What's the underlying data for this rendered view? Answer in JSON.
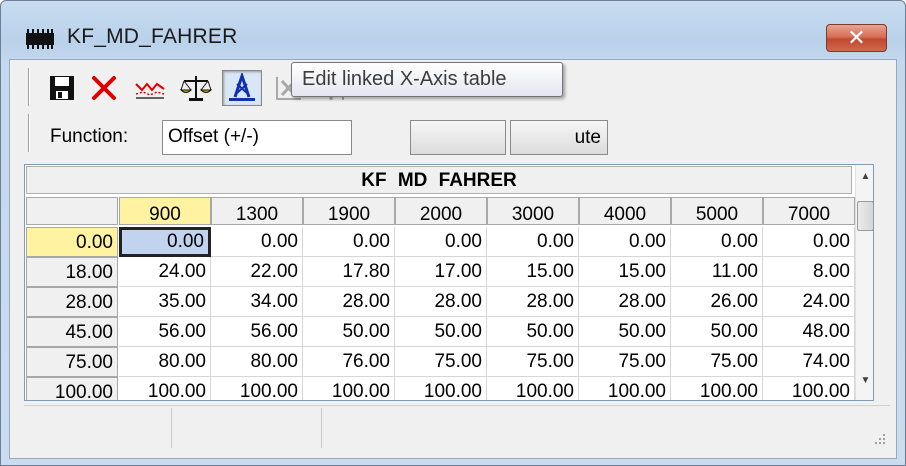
{
  "window": {
    "title": "KF_MD_FAHRER",
    "close_label": "✕"
  },
  "toolbar": {
    "buttons": [
      {
        "icon": "save-icon"
      },
      {
        "icon": "delete-icon"
      },
      {
        "icon": "line-chart-icon"
      },
      {
        "icon": "balance-scale-icon"
      },
      {
        "icon": "x-axis-table-icon",
        "active": true
      },
      {
        "icon": "x-axis-disabled-icon"
      },
      {
        "icon": "y-axis-disabled-icon"
      }
    ]
  },
  "function_bar": {
    "label": "Function:",
    "selected": "Offset (+/-)",
    "compute_label_visible": "ute"
  },
  "tooltip": {
    "text": "Edit linked X-Axis table"
  },
  "table": {
    "title": "KF  MD  FAHRER",
    "column_headers": [
      "900",
      "1300",
      "1900",
      "2000",
      "3000",
      "4000",
      "5000",
      "7000"
    ],
    "rows": [
      {
        "header": "0.00",
        "values": [
          "0.00",
          "0.00",
          "0.00",
          "0.00",
          "0.00",
          "0.00",
          "0.00",
          "0.00"
        ]
      },
      {
        "header": "18.00",
        "values": [
          "24.00",
          "22.00",
          "17.80",
          "17.00",
          "15.00",
          "15.00",
          "11.00",
          "8.00"
        ]
      },
      {
        "header": "28.00",
        "values": [
          "35.00",
          "34.00",
          "28.00",
          "28.00",
          "28.00",
          "28.00",
          "26.00",
          "24.00"
        ]
      },
      {
        "header": "45.00",
        "values": [
          "56.00",
          "56.00",
          "50.00",
          "50.00",
          "50.00",
          "50.00",
          "50.00",
          "48.00"
        ]
      },
      {
        "header": "75.00",
        "values": [
          "80.00",
          "80.00",
          "76.00",
          "75.00",
          "75.00",
          "75.00",
          "75.00",
          "74.00"
        ]
      },
      {
        "header": "100.00",
        "values": [
          "100.00",
          "100.00",
          "100.00",
          "100.00",
          "100.00",
          "100.00",
          "100.00",
          "100.00"
        ]
      }
    ],
    "selected_column_index": 0,
    "selected_row_index": 0
  },
  "colors": {
    "selected_header": "#fff2a0",
    "selected_cell": "#c1d3ef",
    "close_button": "#c04a30"
  }
}
